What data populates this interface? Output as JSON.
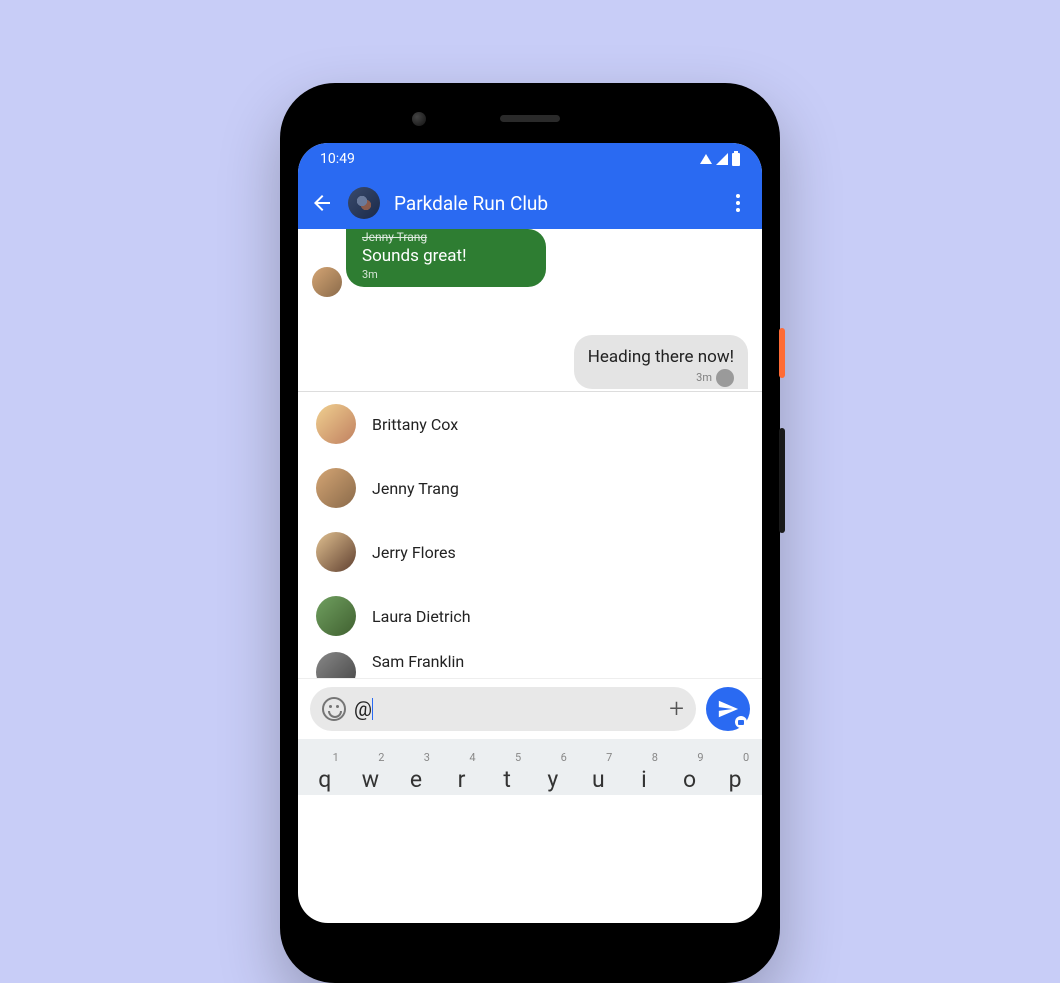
{
  "status": {
    "time": "10:49"
  },
  "header": {
    "chat_title": "Parkdale Run Club"
  },
  "messages": {
    "incoming": {
      "sender": "Jenny Trang",
      "text": "Sounds great!",
      "time": "3m"
    },
    "outgoing": {
      "text": "Heading there now!",
      "time": "3m"
    }
  },
  "mentions": [
    {
      "name": "Brittany Cox"
    },
    {
      "name": "Jenny Trang"
    },
    {
      "name": "Jerry Flores"
    },
    {
      "name": "Laura Dietrich"
    },
    {
      "name": "Sam Franklin"
    }
  ],
  "composer": {
    "value": "@"
  },
  "keyboard": {
    "row1": [
      {
        "key": "q",
        "hint": "1"
      },
      {
        "key": "w",
        "hint": "2"
      },
      {
        "key": "e",
        "hint": "3"
      },
      {
        "key": "r",
        "hint": "4"
      },
      {
        "key": "t",
        "hint": "5"
      },
      {
        "key": "y",
        "hint": "6"
      },
      {
        "key": "u",
        "hint": "7"
      },
      {
        "key": "i",
        "hint": "8"
      },
      {
        "key": "o",
        "hint": "9"
      },
      {
        "key": "p",
        "hint": "0"
      }
    ]
  }
}
